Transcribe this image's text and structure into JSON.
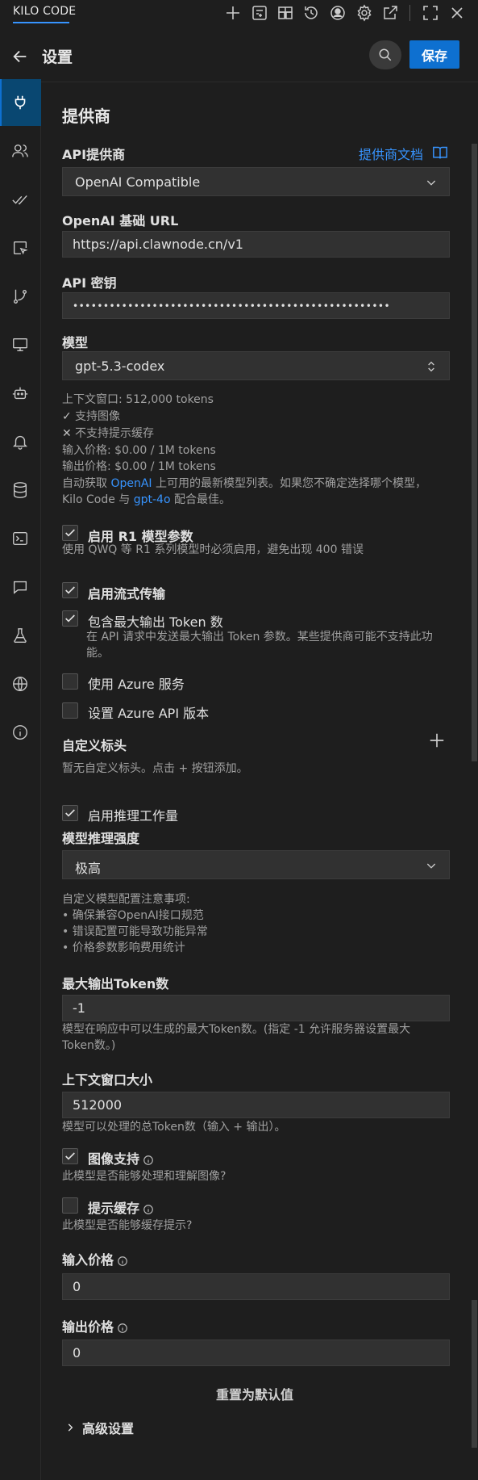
{
  "topbar": {
    "app_title": "KILO CODE",
    "icons": [
      "plus-icon",
      "history-book-icon",
      "marketplace-icon",
      "history-icon",
      "account-icon",
      "settings-icon",
      "popout-icon",
      "fullscreen-icon",
      "close-icon"
    ]
  },
  "header": {
    "title": "设置",
    "save_label": "保存"
  },
  "sidebar": {
    "items": [
      {
        "name": "providers",
        "icon": "plug-icon",
        "active": true
      },
      {
        "name": "users",
        "icon": "users-icon"
      },
      {
        "name": "auto-approve",
        "icon": "check-check-icon"
      },
      {
        "name": "browser",
        "icon": "pointer-icon"
      },
      {
        "name": "checkpoints",
        "icon": "git-branch-icon"
      },
      {
        "name": "display",
        "icon": "monitor-icon"
      },
      {
        "name": "agent",
        "icon": "bot-icon"
      },
      {
        "name": "notifications",
        "icon": "bell-icon"
      },
      {
        "name": "context",
        "icon": "database-icon"
      },
      {
        "name": "terminal",
        "icon": "terminal-icon"
      },
      {
        "name": "prompts",
        "icon": "message-icon"
      },
      {
        "name": "experimental",
        "icon": "flask-icon"
      },
      {
        "name": "language",
        "icon": "globe-icon"
      },
      {
        "name": "about",
        "icon": "info-icon"
      }
    ]
  },
  "provider": {
    "section_title": "提供商",
    "api_provider_label": "API提供商",
    "docs_link": "提供商文档",
    "api_provider_value": "OpenAI Compatible",
    "base_url_label": "OpenAI 基础 URL",
    "base_url_value": "https://api.clawnode.cn/v1",
    "api_key_label": "API 密钥",
    "api_key_value": "••••••••••••••••••••••••••••••••••••••••••••••••••••",
    "model_label": "模型",
    "model_value": "gpt-5.3-codex"
  },
  "model_info": {
    "context_window": "上下文窗口: 512,000 tokens",
    "images": "支持图像",
    "cache": "不支持提示缓存",
    "input_price": "输入价格: $0.00 / 1M tokens",
    "output_price": "输出价格: $0.00 / 1M tokens",
    "fetch_prefix": "自动获取 ",
    "fetch_link": "OpenAI",
    "fetch_suffix": " 上可用的最新模型列表。如果您不确定选择哪个模型，",
    "fetch_line2_prefix": "Kilo Code 与 ",
    "fetch_line2_link": "gpt-4o",
    "fetch_line2_suffix": " 配合最佳。"
  },
  "options": {
    "r1_label": "启用 R1 模型参数",
    "r1_desc": "使用 QWQ 等 R1 系列模型时必须启用，避免出现 400 错误",
    "r1_checked": true,
    "streaming_label": "启用流式传输",
    "streaming_checked": true,
    "max_tokens_label": "包含最大输出 Token 数",
    "max_tokens_desc_1": "在 API 请求中发送最大输出 Token 参数。某些提供商可能不支持此功",
    "max_tokens_desc_2": "能。",
    "max_tokens_checked": true,
    "azure_label": "使用 Azure 服务",
    "azure_checked": false,
    "azure_version_label": "设置 Azure API 版本",
    "azure_version_checked": false
  },
  "headers": {
    "title": "自定义标头",
    "empty": "暂无自定义标头。点击 + 按钮添加。"
  },
  "reasoning": {
    "enable_label": "启用推理工作量",
    "enable_checked": true,
    "effort_label": "模型推理强度",
    "effort_value": "极高"
  },
  "custom_notes": {
    "line1": "自定义模型配置注意事项:",
    "line2": "• 确保兼容OpenAI接口规范",
    "line3": "• 错误配置可能导致功能异常",
    "line4": "• 价格参数影响费用统计"
  },
  "max_output": {
    "label": "最大输出Token数",
    "value": "-1",
    "desc_1": "模型在响应中可以生成的最大Token数。(指定 -1 允许服务器设置最大",
    "desc_2": "Token数。)"
  },
  "context_size": {
    "label": "上下文窗口大小",
    "value": "512000",
    "desc": "模型可以处理的总Token数（输入 + 输出）。"
  },
  "image_support": {
    "label": "图像支持",
    "checked": true,
    "desc": "此模型是否能够处理和理解图像?"
  },
  "prompt_cache": {
    "label": "提示缓存",
    "checked": false,
    "desc": "此模型是否能够缓存提示?"
  },
  "pricing": {
    "input_label": "输入价格",
    "input_value": "0",
    "output_label": "输出价格",
    "output_value": "0"
  },
  "footer": {
    "reset_label": "重置为默认值",
    "advanced_label": "高级设置"
  },
  "colors": {
    "accent": "#0e70d0",
    "link": "#3794ff",
    "background": "#1e1e1e",
    "input_bg": "#313131"
  }
}
